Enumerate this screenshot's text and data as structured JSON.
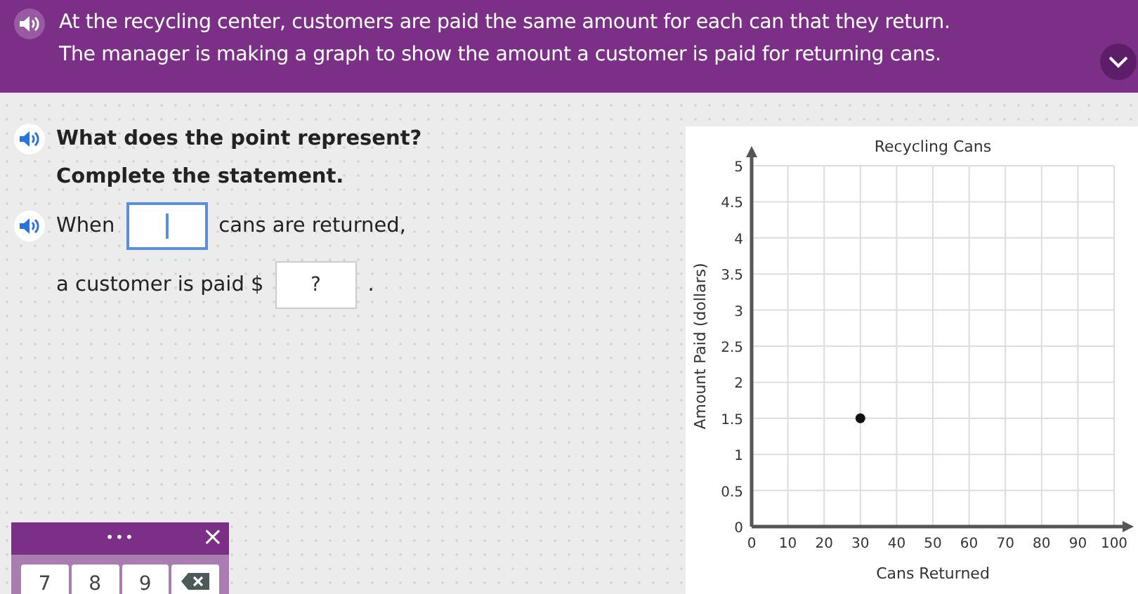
{
  "header": {
    "lines": [
      "At the recycling center, customers are paid the same amount for each can that they return.",
      "The manager is making a graph to show the amount a customer is paid for returning cans."
    ]
  },
  "question": {
    "prompt": "What does the point represent?",
    "instruction": "Complete the statement.",
    "line1_before": "When",
    "line1_after": "cans are returned,",
    "line2_before": "a customer is paid $",
    "answer_placeholder": "?",
    "line2_after": "."
  },
  "keypad": {
    "menu": "•••",
    "close": "×",
    "keys": [
      "7",
      "8",
      "9"
    ]
  },
  "chart": {
    "chart_data": {
      "type": "scatter",
      "title": "Recycling Cans",
      "xlabel": "Cans Returned",
      "ylabel": "Amount Paid (dollars)",
      "x": [
        30
      ],
      "series": [
        {
          "values": [
            1.5
          ]
        }
      ],
      "grid": true,
      "xlim": [
        0,
        100
      ],
      "ylim": [
        0,
        5
      ],
      "xticks": [
        0,
        10,
        20,
        30,
        40,
        50,
        60,
        70,
        80,
        90,
        100
      ],
      "yticks": [
        0,
        0.5,
        1,
        1.5,
        2,
        2.5,
        3,
        3.5,
        4,
        4.5,
        5
      ]
    }
  }
}
